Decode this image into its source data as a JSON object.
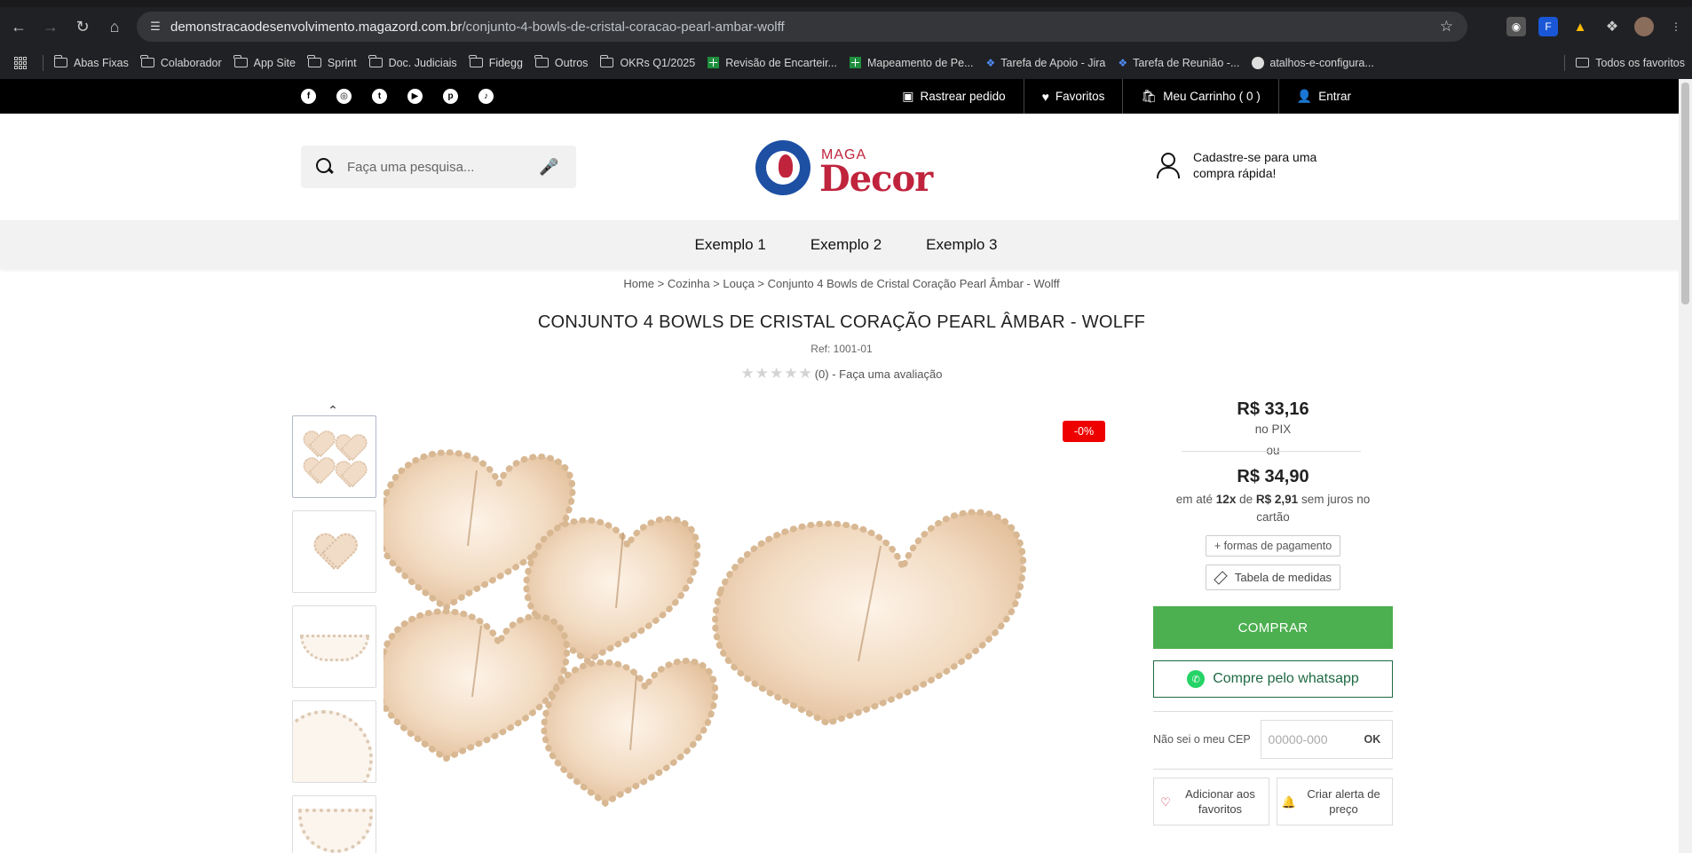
{
  "browser": {
    "url_host": "demonstracaodesenvolvimento.magazord.com.br",
    "url_path": "/conjunto-4-bowls-de-cristal-coracao-pearl-ambar-wolff",
    "bookmarks": [
      {
        "label": "Abas Fixas",
        "icon": "folder-icon"
      },
      {
        "label": "Colaborador",
        "icon": "folder-icon"
      },
      {
        "label": "App Site",
        "icon": "folder-icon"
      },
      {
        "label": "Sprint",
        "icon": "folder-icon"
      },
      {
        "label": "Doc. Judiciais",
        "icon": "folder-icon"
      },
      {
        "label": "Fidegg",
        "icon": "folder-icon"
      },
      {
        "label": "Outros",
        "icon": "folder-icon"
      },
      {
        "label": "OKRs Q1/2025",
        "icon": "folder-icon"
      },
      {
        "label": "Revisão de Encarteir...",
        "icon": "sheets-icon"
      },
      {
        "label": "Mapeamento de Pe...",
        "icon": "sheets-icon"
      },
      {
        "label": "Tarefa de Apoio - Jira",
        "icon": "jira-icon"
      },
      {
        "label": "Tarefa de Reunião -...",
        "icon": "jira-icon"
      },
      {
        "label": "atalhos-e-configura...",
        "icon": "github-icon"
      }
    ],
    "all_bookmarks": "Todos os favoritos"
  },
  "topbar": {
    "track_order": "Rastrear pedido",
    "favorites": "Favoritos",
    "cart": "Meu Carrinho",
    "cart_count": "( 0 )",
    "login": "Entrar"
  },
  "header": {
    "search_placeholder": "Faça uma pesquisa...",
    "logo_top": "MAGA",
    "logo_main": "Decor",
    "signup_text": "Cadastre-se para uma compra rápida!"
  },
  "nav": [
    "Exemplo 1",
    "Exemplo 2",
    "Exemplo 3"
  ],
  "breadcrumb": [
    "Home",
    "Cozinha",
    "Louça",
    "Conjunto 4 Bowls de Cristal Coração Pearl Âmbar - Wolff"
  ],
  "product": {
    "title": "CONJUNTO 4 BOWLS DE CRISTAL CORAÇÃO PEARL ÂMBAR - WOLFF",
    "ref": "Ref: 1001-01",
    "rating_count": "(0)",
    "rating_link": "- Faça uma avaliação",
    "rating_value": 0,
    "discount": "-0%"
  },
  "pricing": {
    "pix_price": "R$ 33,16",
    "pix_label": "no PIX",
    "or": "ou",
    "price": "R$ 34,90",
    "inst_prefix": "em até",
    "inst_count": "12x",
    "inst_mid": "de",
    "inst_value": "R$ 2,91",
    "inst_suffix": "sem juros no cartão",
    "payment_methods": "+ formas de pagamento",
    "size_table": "Tabela de medidas",
    "buy": "COMPRAR",
    "whatsapp": "Compre pelo whatsapp",
    "cep_label": "Não sei o meu CEP",
    "cep_placeholder": "00000-000",
    "cep_ok": "OK",
    "add_fav": "Adicionar aos favoritos",
    "price_alert": "Criar alerta de preço"
  }
}
